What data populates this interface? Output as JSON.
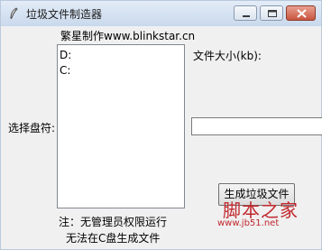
{
  "window": {
    "title": "垃圾文件制造器",
    "icon": "feather-icon"
  },
  "main": {
    "header_text": "繁星制作www.blinkstar.cn",
    "drive_label": "选择盘符:",
    "drives": [
      "D:",
      "C:"
    ],
    "size_label": "文件大小(kb):",
    "size_value": "",
    "generate_button": "生成垃圾文件",
    "note_line1": "注：无管理员权限运行",
    "note_line2": "无法在C盘生成文件"
  },
  "watermark": {
    "text": "脚本之家",
    "url": "www.jb51.net"
  },
  "colors": {
    "watermark": "#c1272d",
    "window_bg": "#f0f0f0"
  }
}
